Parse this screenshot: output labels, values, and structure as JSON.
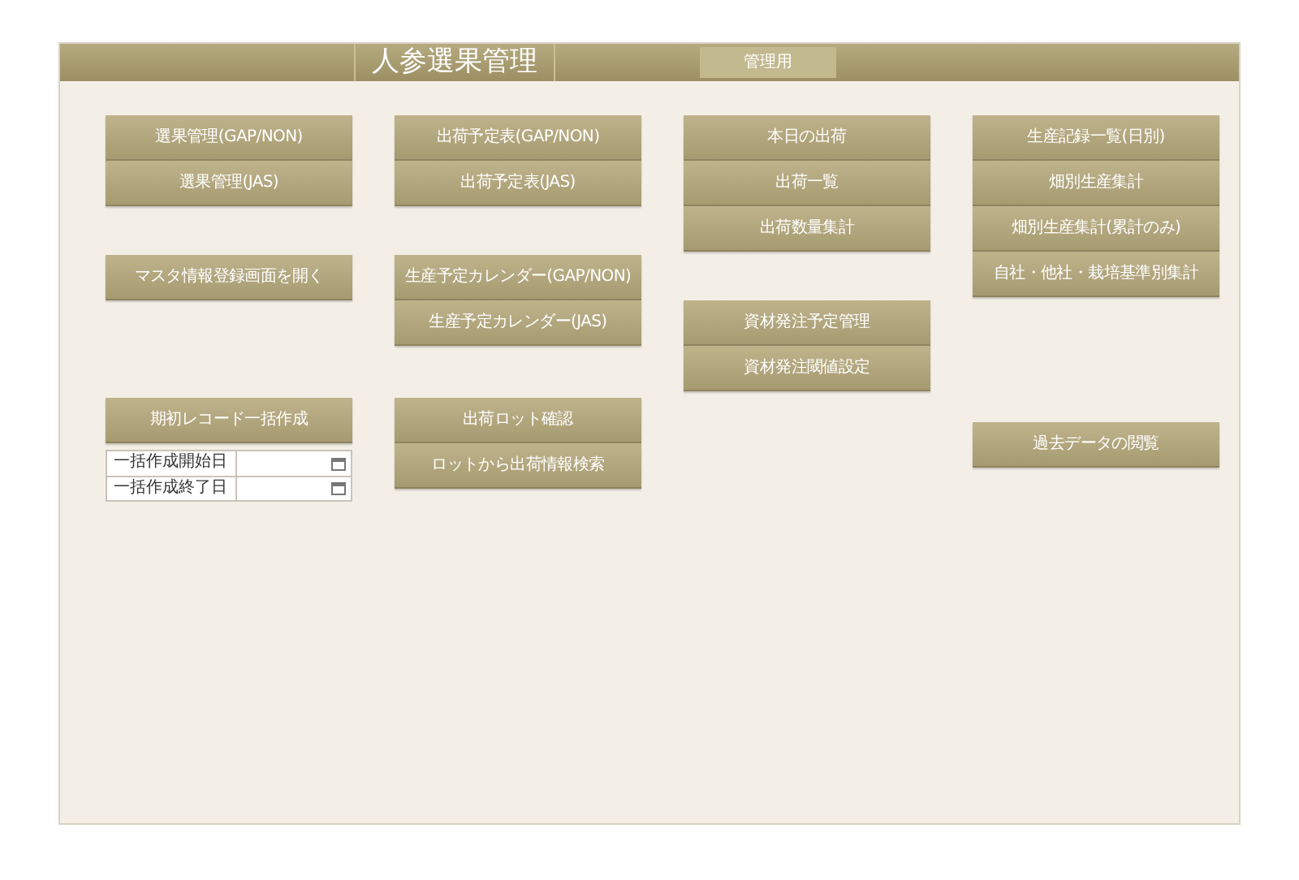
{
  "header": {
    "title": "人参選果管理",
    "admin_button": "管理用"
  },
  "columns": [
    {
      "groups": [
        {
          "buttons": [
            "選果管理(GAP/NON)",
            "選果管理(JAS)"
          ]
        },
        {
          "buttons": [
            "マスタ情報登録画面を開く"
          ]
        },
        {
          "buttons": [
            "期初レコード一括作成"
          ],
          "date_fields": [
            {
              "label": "一括作成開始日"
            },
            {
              "label": "一括作成終了日"
            }
          ]
        }
      ]
    },
    {
      "groups": [
        {
          "buttons": [
            "出荷予定表(GAP/NON)",
            "出荷予定表(JAS)"
          ]
        },
        {
          "buttons": [
            "生産予定カレンダー(GAP/NON)",
            "生産予定カレンダー(JAS)"
          ]
        },
        {
          "buttons": [
            "出荷ロット確認",
            "ロットから出荷情報検索"
          ]
        }
      ]
    },
    {
      "groups": [
        {
          "buttons": [
            "本日の出荷",
            "出荷一覧",
            "出荷数量集計"
          ]
        },
        {
          "buttons": [
            "資材発注予定管理",
            "資材発注閾値設定"
          ]
        }
      ]
    },
    {
      "groups": [
        {
          "buttons": [
            "生産記録一覧(日別)",
            "畑別生産集計",
            "畑別生産集計(累計のみ)",
            "自社・他社・栽培基準別集計"
          ]
        },
        {
          "buttons": [
            "過去データの閲覧"
          ]
        }
      ]
    }
  ]
}
